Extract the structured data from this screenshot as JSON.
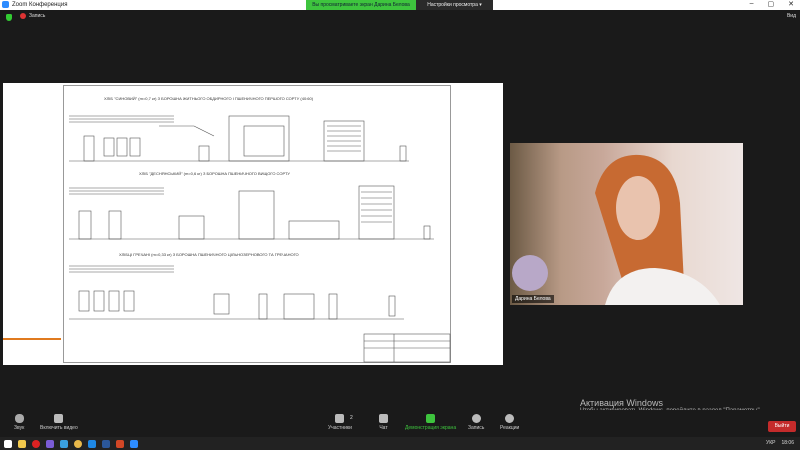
{
  "window": {
    "title": "Zoom Конференция",
    "minimize": "–",
    "maximize": "▢",
    "close": "✕"
  },
  "banner": {
    "text": "Вы просматриваете экран Дарина Белова",
    "view_options": "Настройки просмотра ▾"
  },
  "topbar": {
    "record": "Запись",
    "view": "Вид"
  },
  "slide": {
    "title1": "ХЛІБ \"СИНОВИЙ\" (m=0,7 кг) З БОРОШНА ЖИТНЬОГО ОБДИРНОГО І ПШЕНИЧНОГО ПЕРШОГО СОРТУ (40:60)",
    "title2": "ХЛІБ \"ДЕСНЯНСЬКИЙ\" (m=0,6 кг) З БОРОШНА ПШЕНИЧНОГО ВИЩОГО СОРТУ",
    "title3": "ХЛІБЦІ ГРЕЧАНІ (m=0,33 кг) З БОРОШНА ПШЕНИЧНОГО ЦІЛЬНОЗЕРНОВОГО ТА ГРЕЧАНОГО"
  },
  "video": {
    "name": "Дарина Белова"
  },
  "watermark": {
    "title": "Активация Windows",
    "subtitle": "Чтобы активировать Windows, перейдите в раздел \"Параметры\"."
  },
  "toolbar": {
    "audio": "Звук",
    "video": "Включить видео",
    "participants": "Участники",
    "participants_count": "2",
    "chat": "Чат",
    "share": "Демонстрация экрана",
    "record": "Запись",
    "reactions": "Реакции",
    "leave": "Выйти"
  },
  "taskbar": {
    "lang": "УКР",
    "time": "18:06"
  },
  "colors": {
    "share": "#3ec43e",
    "leave": "#c42b2b",
    "accent": "#e07a1f"
  }
}
